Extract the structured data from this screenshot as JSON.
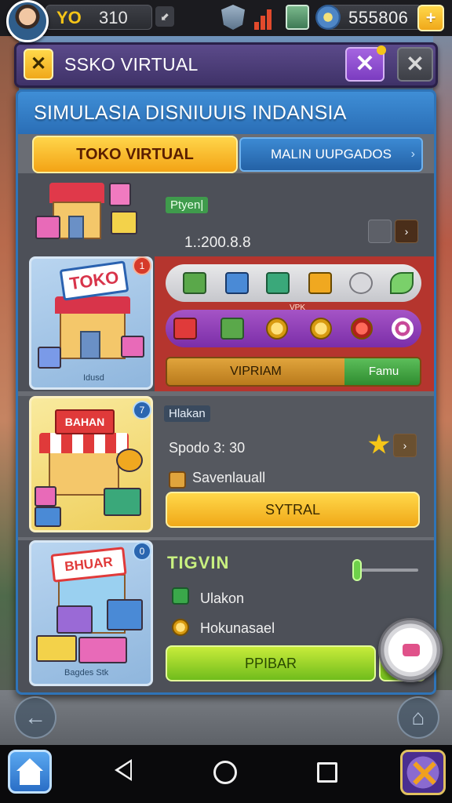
{
  "topbar": {
    "level_label": "YO",
    "level_value": "310",
    "money": "555806",
    "plus_label": "+",
    "arrow": "⬋"
  },
  "title": {
    "back_label": "✕",
    "text": "SSKO VIRTUAL",
    "close_label": "✕"
  },
  "panel": {
    "heading": "SIMULASIA DISNIUUIS INDANSIA",
    "tabs": [
      {
        "label": "TOKO VIRTUAL",
        "active": true
      },
      {
        "label": "MALIN UUPGADOS",
        "active": false
      }
    ]
  },
  "row1": {
    "tag": "Ptyen|",
    "price": "1.:200.8.8",
    "go": "›"
  },
  "row2": {
    "sign": "TOKO",
    "badge": "1",
    "caption": "Idusd",
    "vpk": "VPK",
    "bar_left": "VIPRIAM",
    "bar_right": "Famu"
  },
  "row3": {
    "badge": "7",
    "sign": "BAHAN",
    "tag": "Hlakan",
    "line1": "Spodo 3: 30",
    "line2": "Savenlauall",
    "go": "›",
    "button": "SYTRAL"
  },
  "row4": {
    "badge": "0",
    "sign": "BHUAR",
    "caption": "Bagdes Stk",
    "title": "TIGVIN",
    "line1": "Ulakon",
    "line2": "Hokunasael",
    "button": "PPIBAR"
  },
  "colors": {
    "accent_yellow": "#f3a315",
    "panel_blue": "#2f74b8",
    "title_purple": "#3f3268",
    "red_area": "#b5352e",
    "green": "#70bc1c"
  },
  "icons": {
    "avatar": "avatar",
    "shield": "shield-icon",
    "signal": "signal-icon",
    "book": "book-icon",
    "gear": "gear-icon",
    "timer": "timer-icon"
  },
  "nav": {
    "left_round": "←",
    "right_round": "⌂"
  }
}
